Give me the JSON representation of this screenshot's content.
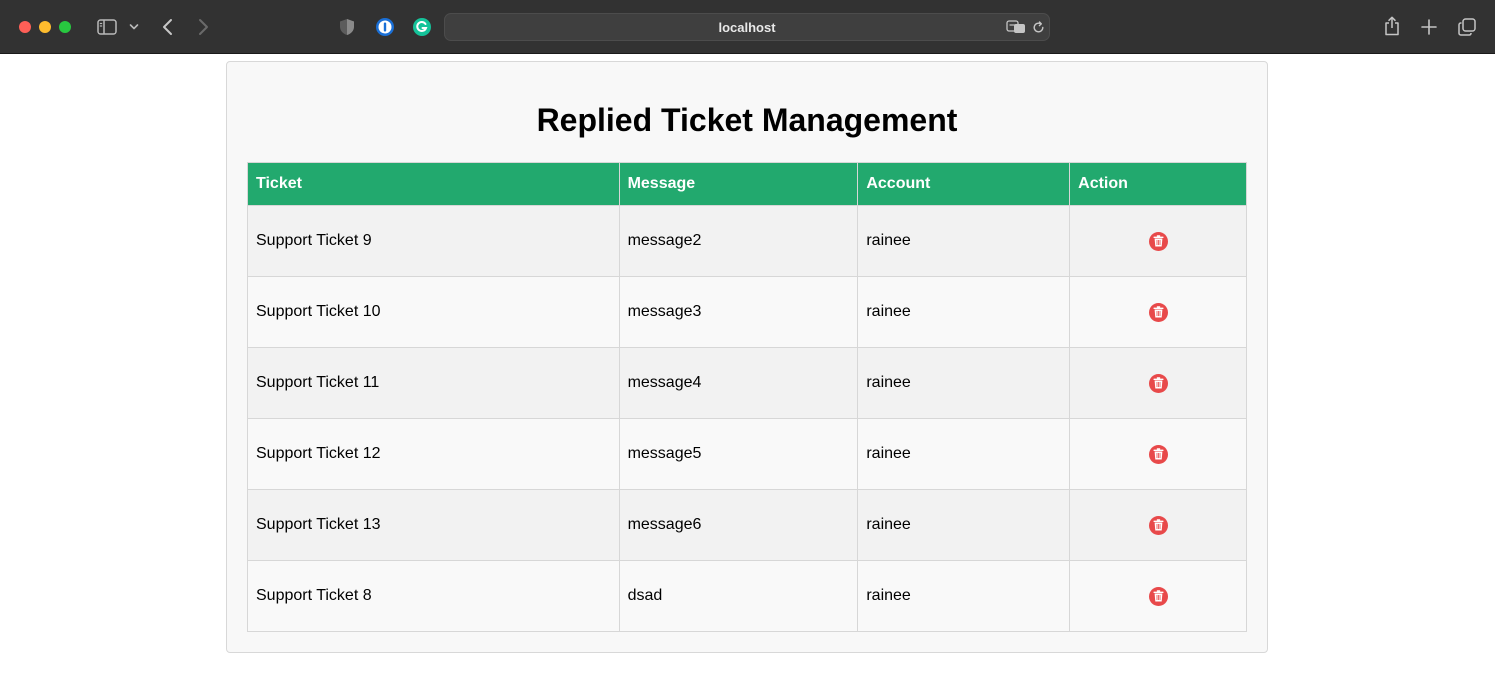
{
  "browser": {
    "url": "localhost"
  },
  "page": {
    "title": "Replied Ticket Management"
  },
  "table": {
    "headers": {
      "ticket": "Ticket",
      "message": "Message",
      "account": "Account",
      "action": "Action"
    },
    "rows": [
      {
        "ticket": "Support Ticket 9",
        "message": "message2",
        "account": "rainee"
      },
      {
        "ticket": "Support Ticket 10",
        "message": "message3",
        "account": "rainee"
      },
      {
        "ticket": "Support Ticket 11",
        "message": "message4",
        "account": "rainee"
      },
      {
        "ticket": "Support Ticket 12",
        "message": "message5",
        "account": "rainee"
      },
      {
        "ticket": "Support Ticket 13",
        "message": "message6",
        "account": "rainee"
      },
      {
        "ticket": "Support Ticket 8",
        "message": "dsad",
        "account": "rainee"
      }
    ],
    "row_action_icon": "trash-icon"
  },
  "colors": {
    "header_green": "#22a96e",
    "delete_red": "#e8494a",
    "toolbar": "#323232"
  }
}
